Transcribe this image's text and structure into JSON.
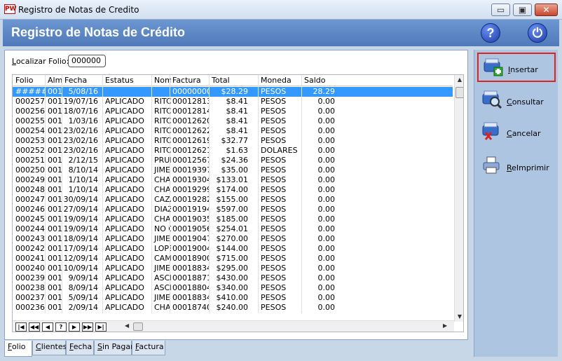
{
  "window": {
    "logo_text": "PW",
    "title": "Registro de Notas de Credito",
    "min_glyph": "▭",
    "max_glyph": "▣",
    "close_glyph": "✕"
  },
  "header": {
    "title": "Registro de Notas de Crédito",
    "help_glyph": "?",
    "power_glyph": "⏻"
  },
  "search": {
    "label_underlined": "L",
    "label_rest": "ocalizar Folio:",
    "value": "000000"
  },
  "grid": {
    "columns": [
      "Folio",
      "Alm",
      "Fecha",
      "Estatus",
      "Nombre",
      "Factura",
      "Total",
      "Moneda",
      "Saldo"
    ],
    "rows": [
      {
        "folio": "######",
        "alm": "001",
        "fecha": "5/08/16",
        "estatus": "",
        "nombre": "",
        "factura": "00000000",
        "total": "$28.29",
        "moneda": "PESOS",
        "saldo": "28.29",
        "selected": true
      },
      {
        "folio": "000257",
        "alm": "001",
        "fecha": "19/07/16",
        "estatus": "APLICADO",
        "nombre": "RITCH",
        "factura": "00012813",
        "total": "$8.41",
        "moneda": "PESOS",
        "saldo": "0.00"
      },
      {
        "folio": "000256",
        "alm": "001",
        "fecha": "18/07/16",
        "estatus": "APLICADO",
        "nombre": "RITCH",
        "factura": "00012814",
        "total": "$8.41",
        "moneda": "PESOS",
        "saldo": "0.00"
      },
      {
        "folio": "000255",
        "alm": "001",
        "fecha": "1/03/16",
        "estatus": "APLICADO",
        "nombre": "RITCH",
        "factura": "00012620",
        "total": "$8.41",
        "moneda": "PESOS",
        "saldo": "0.00"
      },
      {
        "folio": "000254",
        "alm": "001",
        "fecha": "23/02/16",
        "estatus": "APLICADO",
        "nombre": "RITCH",
        "factura": "00012622",
        "total": "$8.41",
        "moneda": "PESOS",
        "saldo": "0.00"
      },
      {
        "folio": "000253",
        "alm": "001",
        "fecha": "23/02/16",
        "estatus": "APLICADO",
        "nombre": "RITCH",
        "factura": "00012619",
        "total": "$32.77",
        "moneda": "PESOS",
        "saldo": "0.00"
      },
      {
        "folio": "000252",
        "alm": "001",
        "fecha": "23/02/16",
        "estatus": "APLICADO",
        "nombre": "RITCH",
        "factura": "00012621",
        "total": "$1.63",
        "moneda": "DOLARES",
        "saldo": "0.00"
      },
      {
        "folio": "000251",
        "alm": "001",
        "fecha": "2/12/15",
        "estatus": "APLICADO",
        "nombre": "PRUE",
        "factura": "00012567",
        "total": "$24.36",
        "moneda": "PESOS",
        "saldo": "0.00"
      },
      {
        "folio": "000250",
        "alm": "001",
        "fecha": "8/10/14",
        "estatus": "APLICADO",
        "nombre": "JIMEN",
        "factura": "00019397",
        "total": "$35.00",
        "moneda": "PESOS",
        "saldo": "0.00"
      },
      {
        "folio": "000249",
        "alm": "001",
        "fecha": "1/10/14",
        "estatus": "APLICADO",
        "nombre": "CHAI",
        "factura": "00019304",
        "total": "$133.01",
        "moneda": "PESOS",
        "saldo": "0.00"
      },
      {
        "folio": "000248",
        "alm": "001",
        "fecha": "1/10/14",
        "estatus": "APLICADO",
        "nombre": "CHAI",
        "factura": "00019299",
        "total": "$174.00",
        "moneda": "PESOS",
        "saldo": "0.00"
      },
      {
        "folio": "000247",
        "alm": "001",
        "fecha": "30/09/14",
        "estatus": "APLICADO",
        "nombre": "CAZA",
        "factura": "00019282",
        "total": "$155.00",
        "moneda": "PESOS",
        "saldo": "0.00"
      },
      {
        "folio": "000246",
        "alm": "001",
        "fecha": "27/09/14",
        "estatus": "APLICADO",
        "nombre": "DIAZ",
        "factura": "00019194",
        "total": "$597.00",
        "moneda": "PESOS",
        "saldo": "0.00"
      },
      {
        "folio": "000245",
        "alm": "001",
        "fecha": "19/09/14",
        "estatus": "APLICADO",
        "nombre": "CHAI",
        "factura": "00019035",
        "total": "$185.00",
        "moneda": "PESOS",
        "saldo": "0.00"
      },
      {
        "folio": "000244",
        "alm": "001",
        "fecha": "19/09/14",
        "estatus": "APLICADO",
        "nombre": "NO Q",
        "factura": "00019056",
        "total": "$254.01",
        "moneda": "PESOS",
        "saldo": "0.00"
      },
      {
        "folio": "000243",
        "alm": "001",
        "fecha": "18/09/14",
        "estatus": "APLICADO",
        "nombre": "JIMEN",
        "factura": "00019047",
        "total": "$270.00",
        "moneda": "PESOS",
        "saldo": "0.00"
      },
      {
        "folio": "000242",
        "alm": "001",
        "fecha": "17/09/14",
        "estatus": "APLICADO",
        "nombre": "LOPE",
        "factura": "00019004",
        "total": "$144.00",
        "moneda": "PESOS",
        "saldo": "0.00"
      },
      {
        "folio": "000241",
        "alm": "001",
        "fecha": "12/09/14",
        "estatus": "APLICADO",
        "nombre": "CAMA",
        "factura": "00018900",
        "total": "$715.00",
        "moneda": "PESOS",
        "saldo": "0.00"
      },
      {
        "folio": "000240",
        "alm": "001",
        "fecha": "10/09/14",
        "estatus": "APLICADO",
        "nombre": "JIMEN",
        "factura": "00018834",
        "total": "$295.00",
        "moneda": "PESOS",
        "saldo": "0.00"
      },
      {
        "folio": "000239",
        "alm": "001",
        "fecha": "9/09/14",
        "estatus": "APLICADO",
        "nombre": "ASCE",
        "factura": "00018871",
        "total": "$430.00",
        "moneda": "PESOS",
        "saldo": "0.00"
      },
      {
        "folio": "000238",
        "alm": "001",
        "fecha": "8/09/14",
        "estatus": "APLICADO",
        "nombre": "ASCE",
        "factura": "00018804",
        "total": "$340.00",
        "moneda": "PESOS",
        "saldo": "0.00"
      },
      {
        "folio": "000237",
        "alm": "001",
        "fecha": "5/09/14",
        "estatus": "APLICADO",
        "nombre": "JIMEN",
        "factura": "00018834",
        "total": "$410.00",
        "moneda": "PESOS",
        "saldo": "0.00"
      },
      {
        "folio": "000236",
        "alm": "001",
        "fecha": "2/09/14",
        "estatus": "APLICADO",
        "nombre": "CHAI",
        "factura": "00018740",
        "total": "$240.00",
        "moneda": "PESOS",
        "saldo": "0.00"
      }
    ],
    "nav_buttons": [
      "|◀",
      "◀◀",
      "◀",
      "?",
      "▶",
      "▶▶",
      "▶|"
    ],
    "scroll_left": "◀",
    "scroll_right": "▶",
    "scroll_up": "▲",
    "scroll_down": "▼"
  },
  "tabs": [
    {
      "u": "F",
      "rest": "olio",
      "active": true
    },
    {
      "u": "C",
      "rest": "lientes",
      "active": false
    },
    {
      "u": "F",
      "rest": "echa",
      "active": false,
      "prefix": ""
    },
    {
      "u": "S",
      "rest": "in Pagar",
      "active": false
    },
    {
      "u": "F",
      "rest": "actura",
      "active": false
    }
  ],
  "sidebar": {
    "buttons": [
      {
        "u": "I",
        "rest": "nsertar",
        "icon": "insert-icon",
        "highlighted": true
      },
      {
        "u": "C",
        "rest": "onsultar",
        "icon": "consult-icon",
        "highlighted": false
      },
      {
        "u": "C",
        "rest": "ancelar",
        "icon": "cancel-icon",
        "highlighted": false
      },
      {
        "u": "R",
        "rest": "eImprimir",
        "icon": "printer-icon",
        "highlighted": false
      }
    ]
  },
  "colors": {
    "header_bg": "#5a84c4",
    "selection": "#3399ff",
    "sidebar_bg": "#aec5e2",
    "highlight_border": "#dd2222"
  }
}
